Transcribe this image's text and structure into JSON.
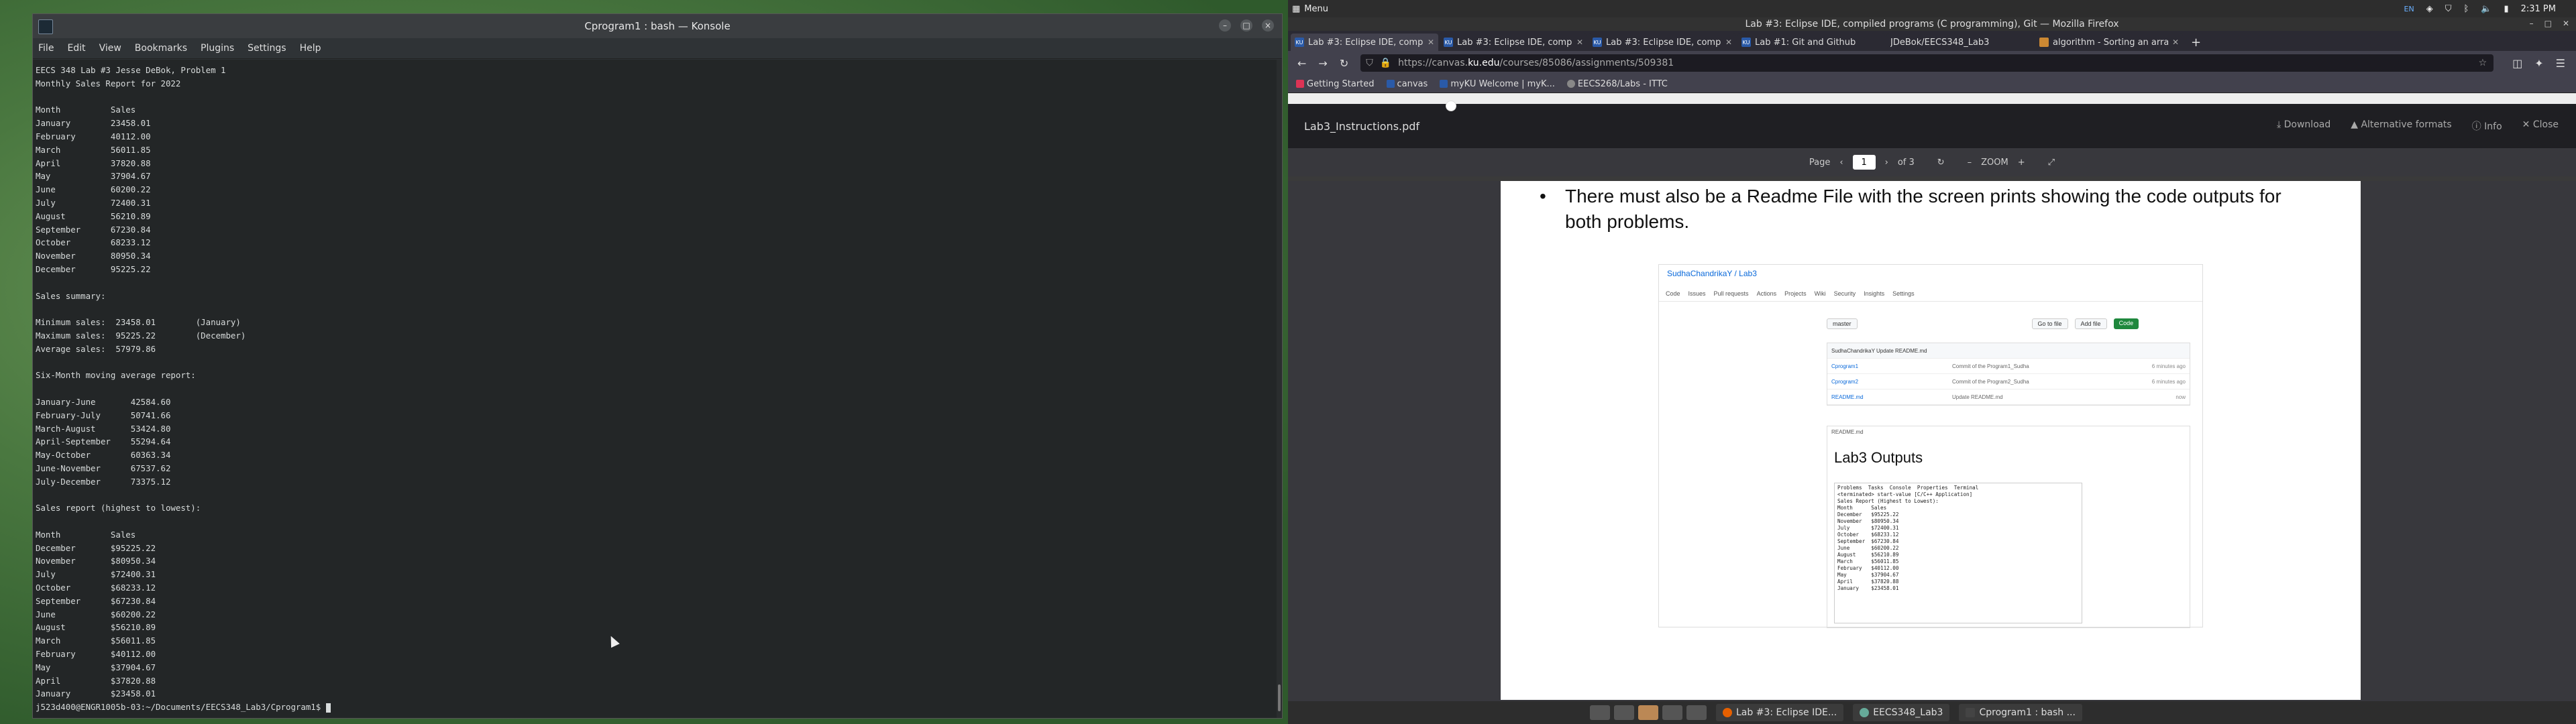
{
  "konsole": {
    "title": "Cprogram1 : bash — Konsole",
    "menu": [
      "File",
      "Edit",
      "View",
      "Bookmarks",
      "Plugins",
      "Settings",
      "Help"
    ],
    "output": "EECS 348 Lab #3 Jesse DeBok, Problem 1\nMonthly Sales Report for 2022\n\nMonth          Sales\nJanuary        23458.01\nFebruary       40112.00\nMarch          56011.85\nApril          37820.88\nMay            37904.67\nJune           60200.22\nJuly           72400.31\nAugust         56210.89\nSeptember      67230.84\nOctober        68233.12\nNovember       80950.34\nDecember       95225.22\n\nSales summary:\n\nMinimum sales:  23458.01        (January)\nMaximum sales:  95225.22        (December)\nAverage sales:  57979.86\n\nSix-Month moving average report:\n\nJanuary-June       42584.60\nFebruary-July      50741.66\nMarch-August       53424.80\nApril-September    55294.64\nMay-October        60363.34\nJune-November      67537.62\nJuly-December      73375.12\n\nSales report (highest to lowest):\n\nMonth          Sales\nDecember       $95225.22\nNovember       $80950.34\nJuly           $72400.31\nOctober        $68233.12\nSeptember      $67230.84\nJune           $60200.22\nAugust         $56210.89\nMarch          $56011.85\nFebruary       $40112.00\nMay            $37904.67\nApril          $37820.88\nJanuary        $23458.01",
    "prompt": "j523d400@ENGR1005b-03:~/Documents/EECS348_Lab3/Cprogram1$ "
  },
  "topbar": {
    "menu_label": "Menu",
    "lang": "EN",
    "time": "2:31 PM"
  },
  "firefox": {
    "title": "Lab #3: Eclipse IDE, compiled programs (C programming), Git — Mozilla Firefox",
    "tabs": [
      {
        "label": "Lab #3: Eclipse IDE, comp",
        "icon": "KU"
      },
      {
        "label": "Lab #3: Eclipse IDE, comp",
        "icon": "KU"
      },
      {
        "label": "Lab #3: Eclipse IDE, comp",
        "icon": "KU"
      },
      {
        "label": "Lab #1: Git and Github",
        "icon": "KU"
      },
      {
        "label": "JDeBok/EECS348_Lab3",
        "icon": "GH"
      },
      {
        "label": "algorithm - Sorting an arra",
        "icon": "SO"
      }
    ],
    "url_pre": "https://canvas.",
    "url_host": "ku.edu",
    "url_post": "/courses/85086/assignments/509381",
    "bookmarks": [
      "Getting Started",
      "canvas",
      "myKU Welcome | myK...",
      "EECS268/Labs - ITTC"
    ]
  },
  "pdf": {
    "filename": "Lab3_Instructions.pdf",
    "download": "Download",
    "alt_formats": "Alternative formats",
    "info": "Info",
    "close": "Close",
    "page_label": "Page",
    "page_num": "1",
    "page_of": "of 3",
    "zoom_label": "ZOOM",
    "bullet": "There must also be a Readme File with the screen prints showing the code outputs for both problems.",
    "gh": {
      "repo": "SudhaChandrikaY / Lab3",
      "nav": [
        "Code",
        "Issues",
        "Pull requests",
        "Actions",
        "Projects",
        "Wiki",
        "Security",
        "Insights",
        "Settings"
      ],
      "branch": "master",
      "goto": "Go to file",
      "addfile": "Add file",
      "code": "Code",
      "files": [
        {
          "name": "SudhaChandrikaY Update README.md",
          "msg": "",
          "time": ""
        },
        {
          "name": "Cprogram1",
          "msg": "Commit of the Program1_Sudha",
          "time": "6 minutes ago"
        },
        {
          "name": "Cprogram2",
          "msg": "Commit of the Program2_Sudha",
          "time": "6 minutes ago"
        },
        {
          "name": "README.md",
          "msg": "Update README.md",
          "time": "now"
        }
      ],
      "readme_label": "README.md",
      "readme_title": "Lab3 Outputs",
      "console": "Problems  Tasks  Console  Properties  Terminal\n<terminated> start-value [C/C++ Application]\nSales Report (Highest to Lowest):\nMonth      Sales\nDecember   $95225.22\nNovember   $80950.34\nJuly       $72400.31\nOctober    $68233.12\nSeptember  $67230.84\nJune       $60200.22\nAugust     $56210.89\nMarch      $56011.85\nFebruary   $40112.00\nMay        $37904.67\nApril      $37820.88\nJanuary    $23458.01"
    }
  },
  "taskbar": {
    "tasks": [
      "Lab #3: Eclipse IDE...",
      "EECS348_Lab3",
      "Cprogram1 : bash ..."
    ]
  }
}
